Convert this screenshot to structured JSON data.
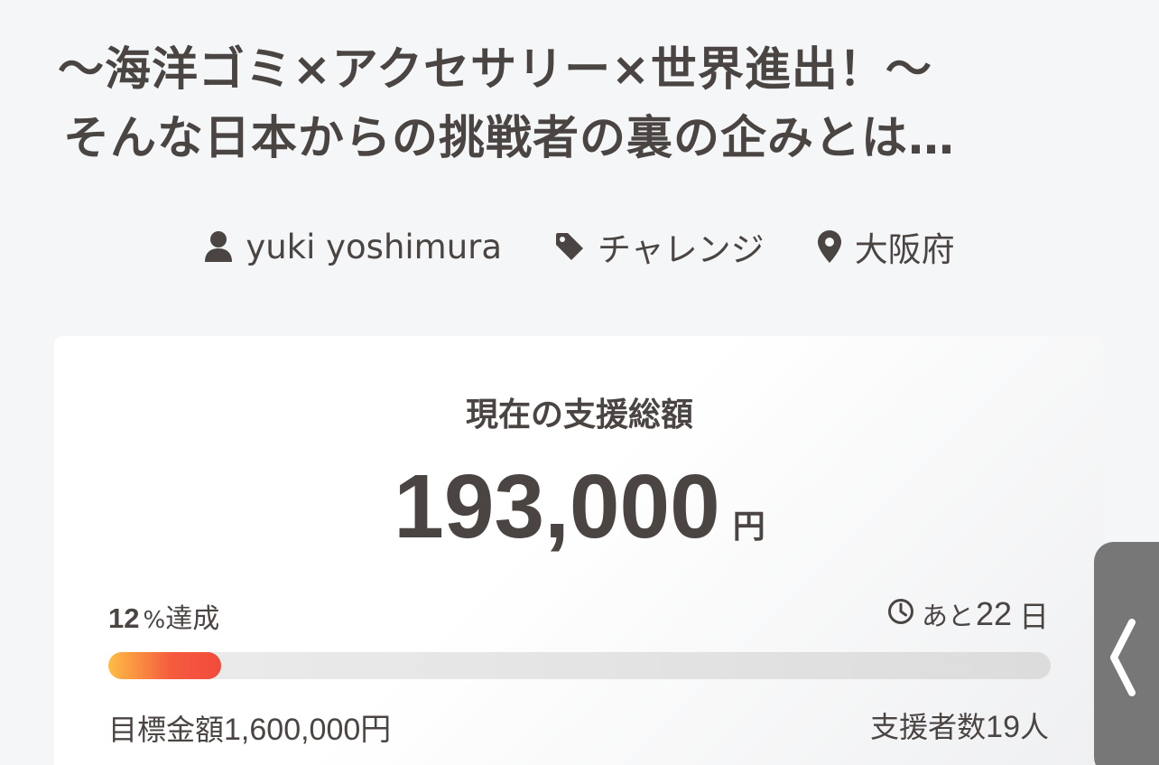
{
  "project": {
    "title_line1": "〜海洋ゴミ×アクセサリー×世界進出！〜",
    "title_line2": "そんな日本からの挑戦者の裏の企みとは…",
    "author": "yuki yoshimura",
    "category": "チャレンジ",
    "location": "大阪府"
  },
  "funding": {
    "heading": "現在の支援総額",
    "amount": "193,000",
    "amount_unit": "円",
    "achieved_percent": "12",
    "percent_sign": "%",
    "achieved_label": "達成",
    "progress_fraction": 0.12,
    "remaining_prefix": "あと",
    "remaining_days": "22",
    "remaining_unit": "日",
    "goal_label": "目標金額",
    "goal_value": "1,600,000円",
    "supporters_label": "支援者数",
    "supporters_count": "19",
    "supporters_unit": "人"
  },
  "icons": {
    "author": "user-icon",
    "category": "tag-icon",
    "location": "map-pin-icon",
    "remaining": "clock-icon",
    "side_tab": "chevron-left-icon"
  },
  "colors": {
    "text": "#4a4442",
    "background": "#f4f6f8",
    "progress_start": "#fdbd45",
    "progress_end": "#f24a3d",
    "side_tab": "#777777"
  }
}
